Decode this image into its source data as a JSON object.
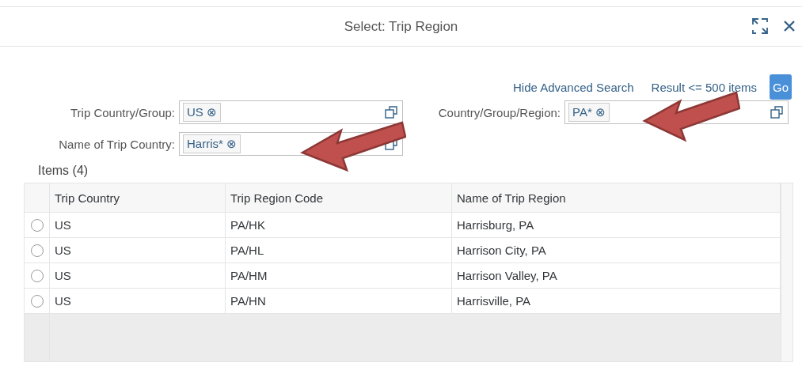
{
  "dialog": {
    "title": "Select: Trip Region"
  },
  "toolbar": {
    "advanced_link": "Hide Advanced Search",
    "result_link": "Result <= 500 items",
    "go_button": "Go"
  },
  "filters": [
    {
      "label": "Trip Country/Group:",
      "tokens": [
        {
          "text": "US",
          "remove": "⊗"
        }
      ]
    },
    {
      "label": "Country/Group/Region:",
      "tokens": [
        {
          "text": "PA*",
          "remove": "⊗"
        }
      ]
    },
    {
      "label": "Name of Trip Country:",
      "tokens": [
        {
          "text": "Harris*",
          "remove": "⊗"
        }
      ]
    }
  ],
  "table": {
    "title": "Items (4)",
    "columns": [
      "Trip Country",
      "Trip Region Code",
      "Name of Trip Region"
    ],
    "rows": [
      {
        "selected": false,
        "cells": [
          "US",
          "PA/HK",
          "Harrisburg, PA"
        ]
      },
      {
        "selected": false,
        "cells": [
          "US",
          "PA/HL",
          "Harrison City, PA"
        ]
      },
      {
        "selected": false,
        "cells": [
          "US",
          "PA/HM",
          "Harrison Valley, PA"
        ]
      },
      {
        "selected": false,
        "cells": [
          "US",
          "PA/HN",
          "Harrisville, PA"
        ]
      }
    ]
  }
}
